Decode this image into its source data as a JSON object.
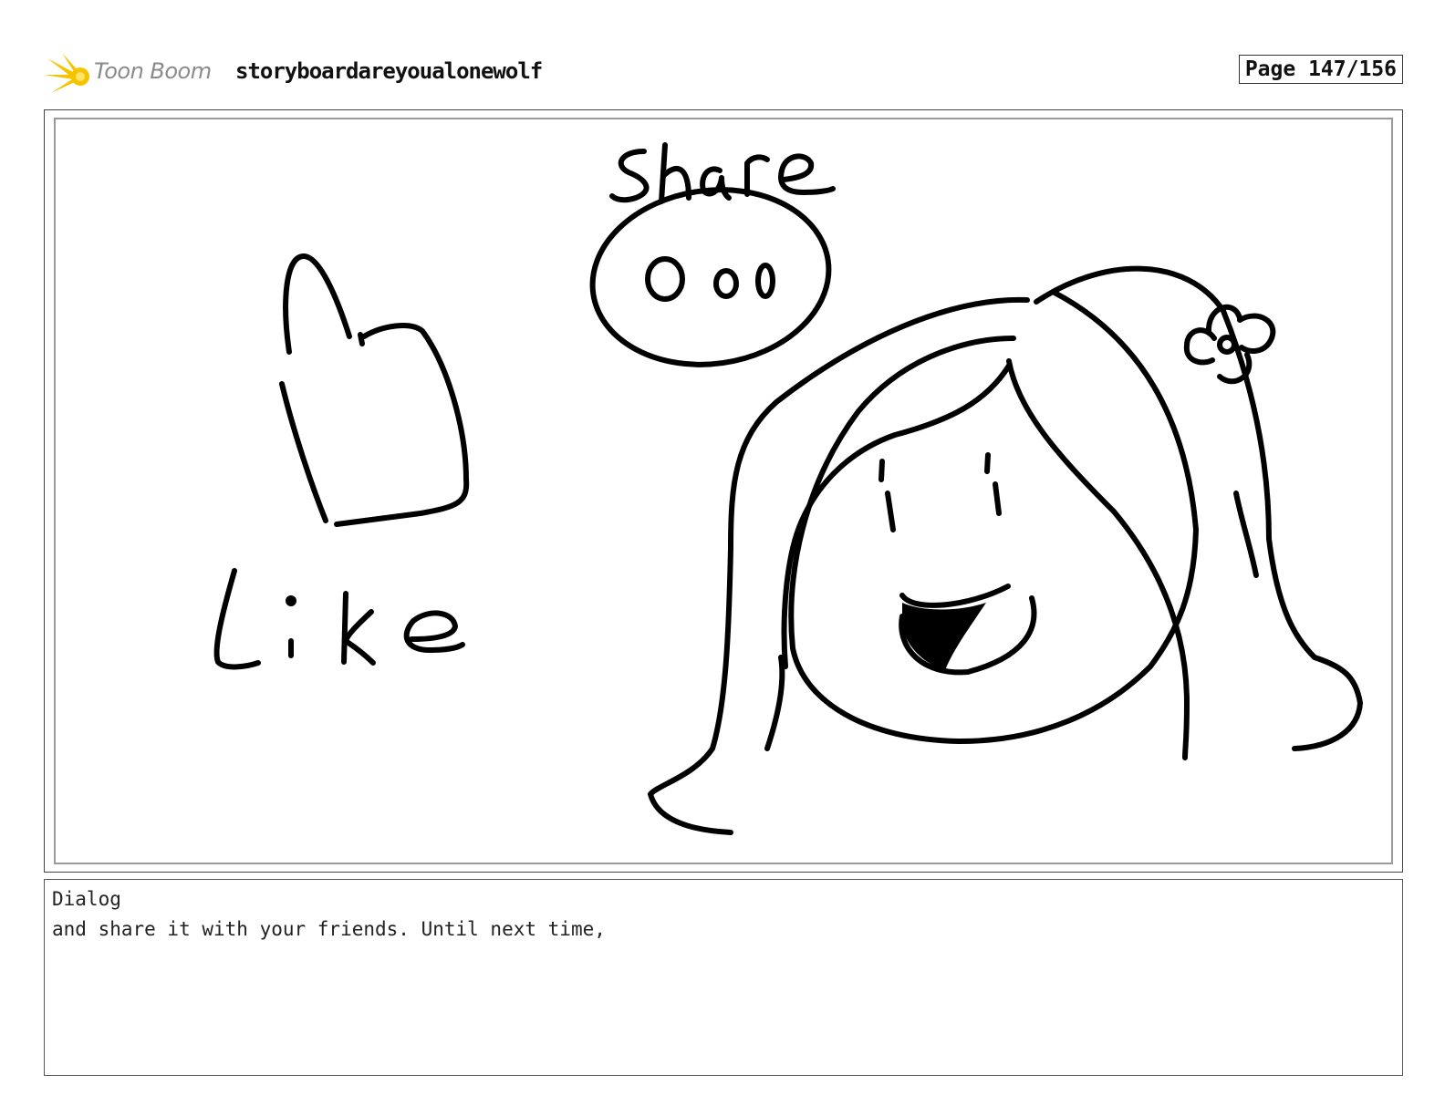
{
  "header": {
    "logo_text": "Toon Boom",
    "project_title": "storyboardareyoualonewolf",
    "page_label": "Page 147/156"
  },
  "panel": {
    "sketch_like_text": "Like",
    "sketch_share_text": "Share"
  },
  "dialog": {
    "label": "Dialog",
    "text": "and share it with your friends. Until next time,"
  },
  "colors": {
    "logo_star": "#f5c400",
    "logo_text": "#8a8a8a",
    "ink": "#000000"
  }
}
